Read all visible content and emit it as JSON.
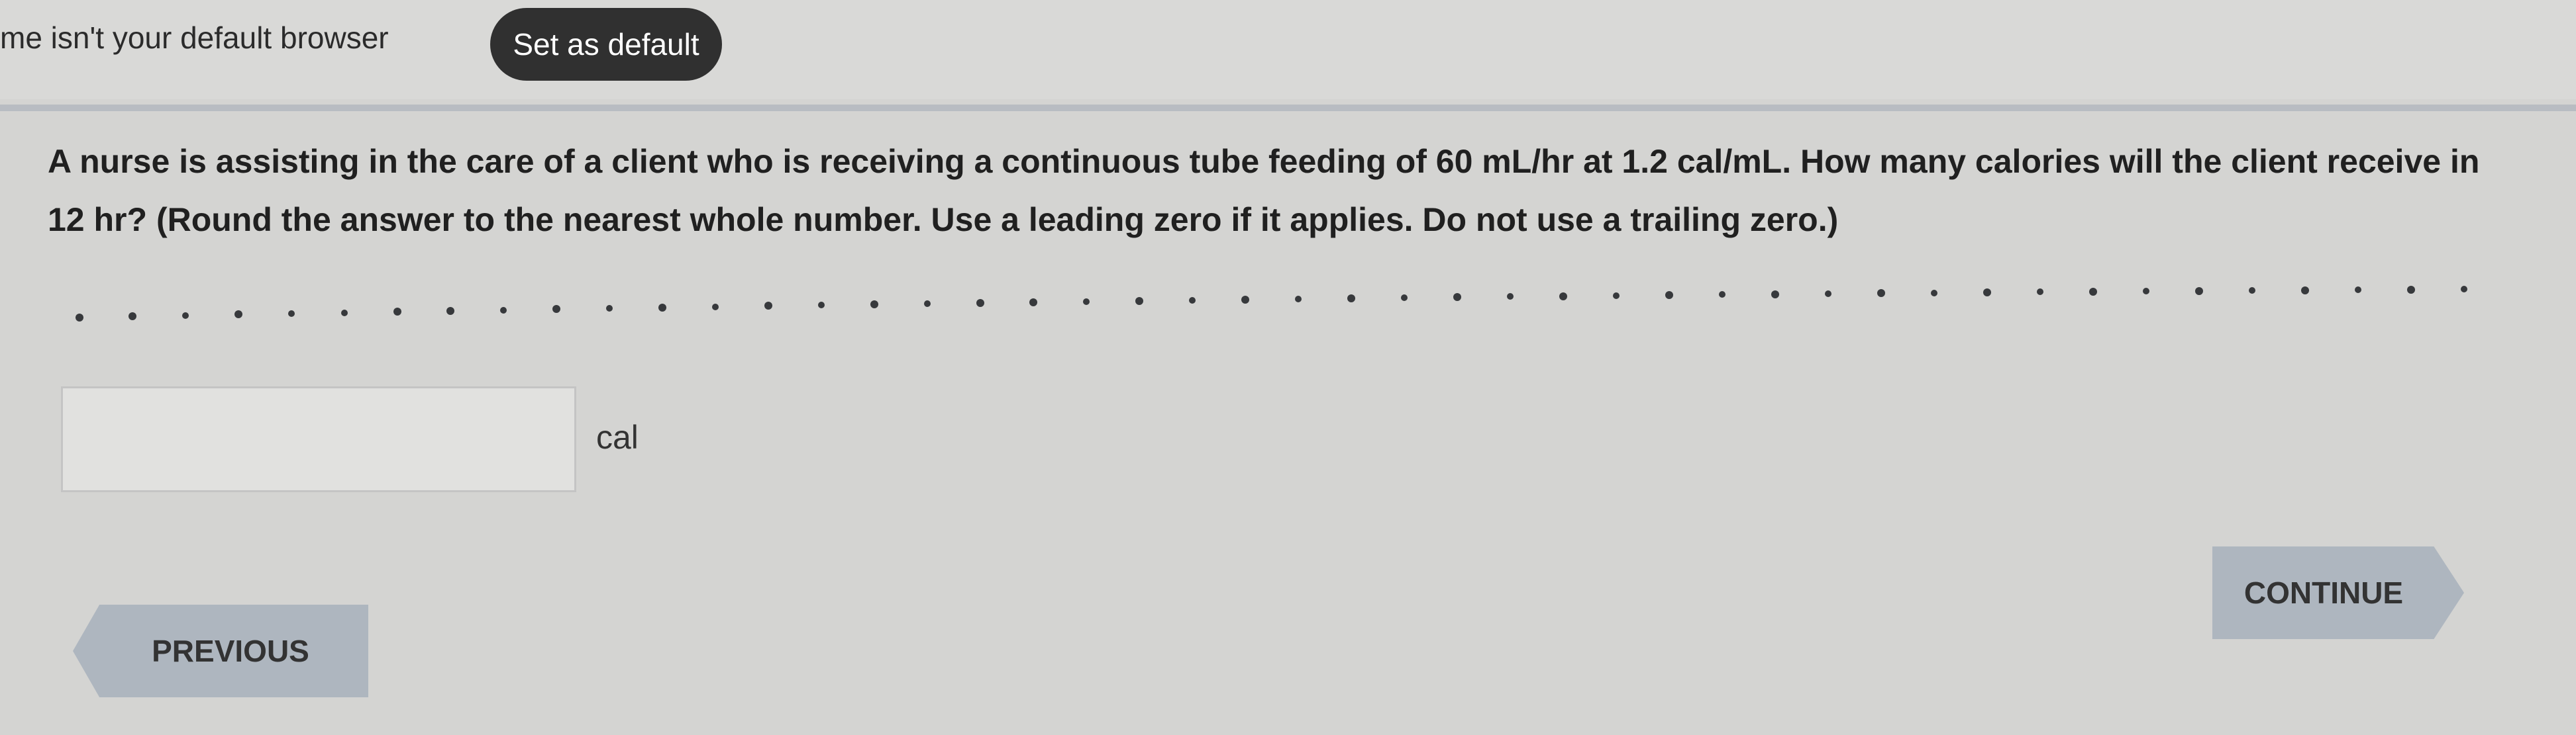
{
  "banner": {
    "message": "me isn't your default browser",
    "set_default_label": "Set as default"
  },
  "question": {
    "text": "A nurse is assisting in the care of a client who is receiving a continuous tube feeding of 60 mL/hr at 1.2 cal/mL. How many calories will the client receive in 12 hr? (Round the answer to the nearest whole number. Use a leading zero if it applies. Do not use a trailing zero.)"
  },
  "answer": {
    "value": "",
    "unit": "cal"
  },
  "navigation": {
    "previous_label": "PREVIOUS",
    "continue_label": "CONTINUE"
  },
  "colors": {
    "background": "#d4d4d2",
    "banner_button": "#303030",
    "nav_button": "#aeb6bf"
  }
}
